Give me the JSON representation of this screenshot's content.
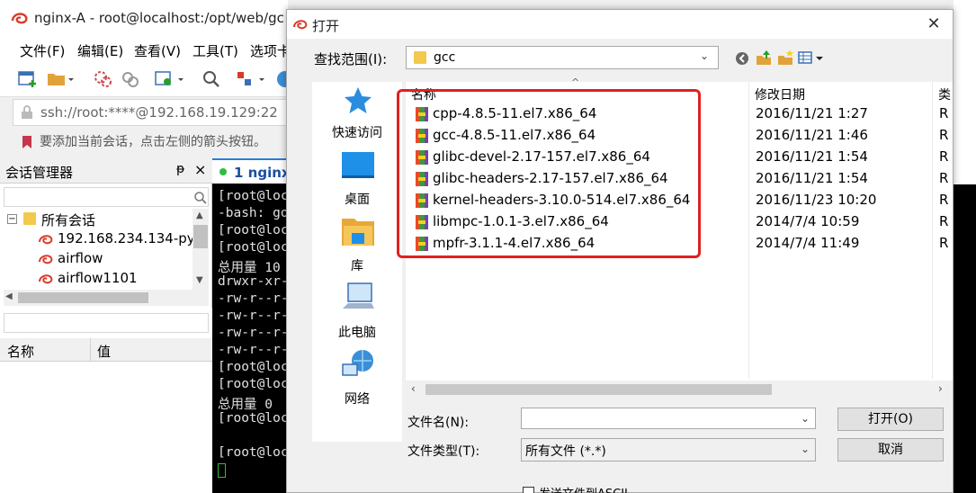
{
  "background_window": {
    "title": "nginx-A - root@localhost:/opt/web/gc",
    "menu": [
      "文件(F)",
      "编辑(E)",
      "查看(V)",
      "工具(T)",
      "选项卡"
    ],
    "address": "ssh://root:****@192.168.19.129:22",
    "hint": "要添加当前会话，点击左侧的箭头按钮。",
    "session_panel": {
      "title": "会话管理器",
      "pin": "ᵽ",
      "close": "×",
      "root": "所有会话",
      "items": [
        "192.168.234.134-pyt",
        "airflow",
        "airflow1101"
      ]
    },
    "properties": {
      "col_name": "名称",
      "col_value": "值"
    },
    "terminal_tab": "1 nginx-",
    "terminal_lines": [
      "[root@loc",
      "-bash: go",
      "[root@loc",
      "[root@loc",
      "总用量 10",
      "drwxr-xr-",
      "-rw-r--r-",
      "-rw-r--r-",
      "-rw-r--r-",
      "-rw-r--r-",
      "[root@loc",
      "[root@loc",
      "总用量 0",
      "[root@loc",
      "",
      "[root@loc"
    ]
  },
  "dialog": {
    "title": "打开",
    "close": "✕",
    "lookin_label": "查找范围(I):",
    "lookin_value": "gcc",
    "places": [
      "快速访问",
      "桌面",
      "库",
      "此电脑",
      "网络"
    ],
    "columns": {
      "name": "名称",
      "date": "修改日期",
      "type": "类"
    },
    "files": [
      {
        "name": "cpp-4.8.5-11.el7.x86_64",
        "date": "2016/11/21 1:27",
        "type": "R"
      },
      {
        "name": "gcc-4.8.5-11.el7.x86_64",
        "date": "2016/11/21 1:46",
        "type": "R"
      },
      {
        "name": "glibc-devel-2.17-157.el7.x86_64",
        "date": "2016/11/21 1:54",
        "type": "R"
      },
      {
        "name": "glibc-headers-2.17-157.el7.x86_64",
        "date": "2016/11/21 1:54",
        "type": "R"
      },
      {
        "name": "kernel-headers-3.10.0-514.el7.x86_64",
        "date": "2016/11/23 10:20",
        "type": "R"
      },
      {
        "name": "libmpc-1.0.1-3.el7.x86_64",
        "date": "2014/7/4 10:59",
        "type": "R"
      },
      {
        "name": "mpfr-3.1.1-4.el7.x86_64",
        "date": "2014/7/4 11:49",
        "type": "R"
      }
    ],
    "filename_label": "文件名(N):",
    "filename_value": "",
    "filetype_label": "文件类型(T):",
    "filetype_value": "所有文件 (*.*)",
    "open_button": "打开(O)",
    "cancel_button": "取消",
    "ascii_label": "发送文件到ASCII"
  },
  "colors": {
    "highlight": "#e02020",
    "accent": "#2a7dd8",
    "terminal_bg": "#000000"
  }
}
